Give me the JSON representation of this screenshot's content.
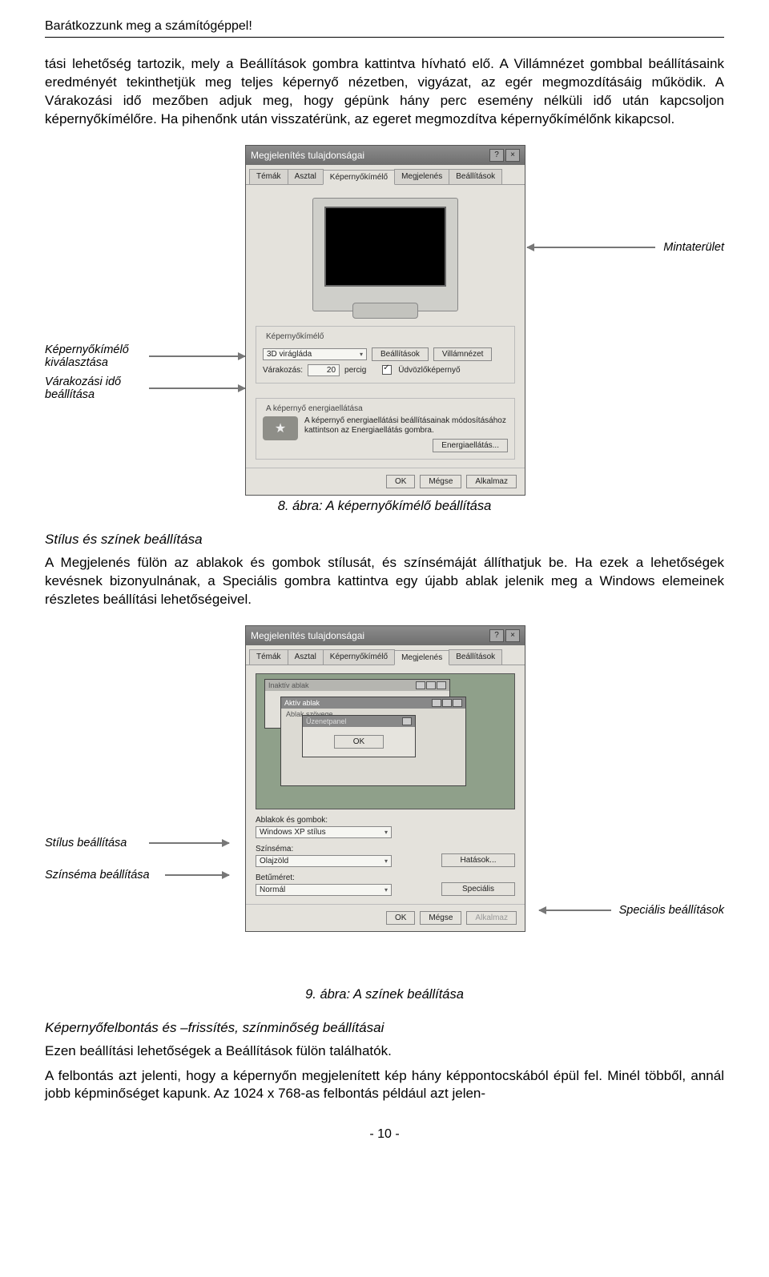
{
  "running_head": "Barátkozzunk meg a számítógéppel!",
  "para1": "tási lehetőség tartozik, mely a Beállítások gombra kattintva hívható elő. A Villámnézet gombbal beállításaink eredményét tekinthetjük meg teljes képernyő nézetben, vigyázat, az egér megmozdításáig működik. A Várakozási idő mezőben adjuk meg, hogy gépünk hány perc esemény nélküli idő után kapcsoljon képernyőkímélőre. Ha pihenőnk után visszatérünk, az egeret megmozdítva képernyőkímélőnk kikapcsol.",
  "annot": {
    "mintaterulet": "Mintaterület",
    "kepernyo_kivalaszt": "Képernyőkímélő kiválasztása",
    "varakozasi_ido": "Várakozási idő beállítása",
    "stilus_beall": "Stílus beállítása",
    "szinsema_beall": "Színséma beállítása",
    "specialis_beall": "Speciális beállítások"
  },
  "dialog1": {
    "title": "Megjelenítés tulajdonságai",
    "tabs": [
      "Témák",
      "Asztal",
      "Képernyőkímélő",
      "Megjelenés",
      "Beállítások"
    ],
    "active_tab": 2,
    "fieldset1_legend": "Képernyőkímélő",
    "screensaver_value": "3D virágláda",
    "btn_beallitasok": "Beállítások",
    "btn_villamnezet": "Villámnézet",
    "wait_label": "Várakozás:",
    "wait_value": "20",
    "wait_unit": "percig",
    "welcome_label": "Üdvözlőképernyő",
    "fieldset2_legend": "A képernyő energiaellátása",
    "energy_text": "A képernyő energiaellátási beállításainak módosításához kattintson az Energiaellátás gombra.",
    "btn_energia": "Energiaellátás...",
    "btn_ok": "OK",
    "btn_megse": "Mégse",
    "btn_alkalmaz": "Alkalmaz"
  },
  "caption1": "8. ábra: A képernyőkímélő beállítása",
  "subhead1": "Stílus és színek beállítása",
  "para2": "A Megjelenés fülön az ablakok és gombok stílusát, és színsémáját állíthatjuk be. Ha ezek a lehetőségek kevésnek bizonyulnának, a Speciális gombra kattintva egy újabb ablak jelenik meg a Windows elemeinek részletes beállítási lehetőségeivel.",
  "dialog2": {
    "title": "Megjelenítés tulajdonságai",
    "tabs": [
      "Témák",
      "Asztal",
      "Képernyőkímélő",
      "Megjelenés",
      "Beállítások"
    ],
    "active_tab": 3,
    "inactive_title": "Inaktív ablak",
    "active_title": "Aktív ablak",
    "active_sub": "Ablak szövege",
    "msg_title": "Üzenetpanel",
    "msg_btn": "OK",
    "lbl_ablakok": "Ablakok és gombok:",
    "val_ablakok": "Windows XP stílus",
    "lbl_szinsema": "Színséma:",
    "val_szinsema": "Olajzöld",
    "lbl_betumeret": "Betűméret:",
    "val_betumeret": "Normál",
    "btn_hatasok": "Hatások...",
    "btn_specialis": "Speciális",
    "btn_ok": "OK",
    "btn_megse": "Mégse",
    "btn_alkalmaz": "Alkalmaz"
  },
  "caption2": "9. ábra: A színek beállítása",
  "subhead2": "Képernyőfelbontás és –frissítés, színminőség beállításai",
  "para3a": "Ezen beállítási lehetőségek a Beállítások fülön találhatók.",
  "para3b": "A felbontás azt jelenti, hogy a képernyőn megjelenített kép hány képpontocskából épül fel. Minél többől, annál jobb képminőséget kapunk. Az 1024 x 768-as felbontás például azt jelen-",
  "pagenum": "- 10 -"
}
